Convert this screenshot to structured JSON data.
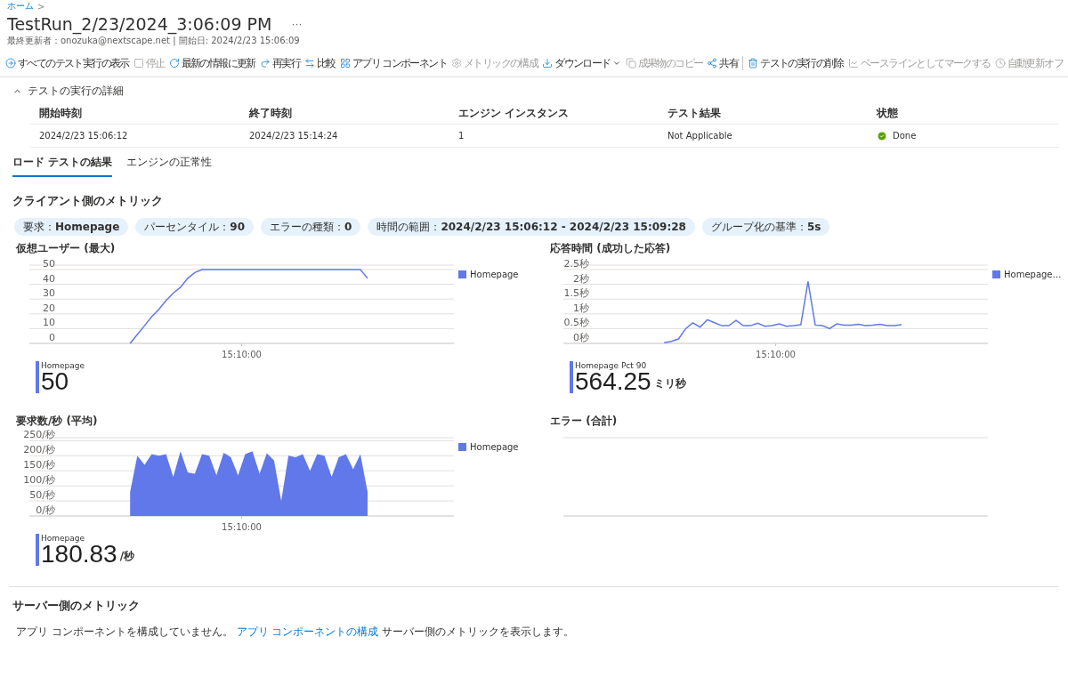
{
  "breadcrumb": {
    "label": "ホーム",
    "separator": ">"
  },
  "header": {
    "title": "TestRun_2/23/2024_3:06:09 PM",
    "more": "···",
    "subtitle": "最終更新者：onozuka@nextscape.net | 開始日: 2024/2/23 15:06:09"
  },
  "toolbar": [
    {
      "kind": "button",
      "label": "すべてのテスト実行の表示",
      "disabled": false
    },
    {
      "kind": "button",
      "label": "停止",
      "disabled": true
    },
    {
      "kind": "button",
      "label": "最新の情報に更新",
      "disabled": false
    },
    {
      "kind": "button",
      "label": "再実行",
      "disabled": false
    },
    {
      "kind": "button",
      "label": "比較",
      "disabled": false
    },
    {
      "kind": "button",
      "label": "アプリ コンポーネント",
      "disabled": false
    },
    {
      "kind": "button",
      "label": "メトリックの構成",
      "disabled": true
    },
    {
      "kind": "dropdown",
      "label": "ダウンロード",
      "disabled": false
    },
    {
      "kind": "button",
      "label": "成果物のコピー",
      "disabled": true
    },
    {
      "kind": "button",
      "label": "共有",
      "disabled": false
    },
    {
      "kind": "separator"
    },
    {
      "kind": "button",
      "label": "テストの実行の削除",
      "disabled": false
    },
    {
      "kind": "button",
      "label": "ベースラインとしてマークする",
      "disabled": true
    },
    {
      "kind": "button",
      "label": "自動更新オフ",
      "disabled": true
    }
  ],
  "details": {
    "title": "テストの実行の詳細",
    "expanded": true,
    "columns": [
      "開始時刻",
      "終了時刻",
      "エンジン インスタンス",
      "テスト結果",
      "状態"
    ],
    "rows": [
      [
        "2024/2/23 15:06:12",
        "2024/2/23 15:14:24",
        "1",
        "Not Applicable",
        "Done"
      ]
    ]
  },
  "tabs": [
    {
      "label": "ロード テストの結果",
      "selected": true
    },
    {
      "label": "エンジンの正常性",
      "selected": false
    }
  ],
  "client_metrics": {
    "title": "クライアント側のメトリック",
    "filters": [
      "要求：**Homepage**",
      "パーセンタイル：**90**",
      "エラーの種類：**0**",
      "時間の範囲：**2024/2/23 15:06:12 - 2024/2/23 15:09:28**",
      "グループ化の基準：**5s**"
    ],
    "panels": [
      {
        "title": "仮想ユーザー (最大)",
        "chart_data": {
          "type": "line",
          "grid": true,
          "ylim": [
            0,
            53
          ],
          "yticks": [
            {
              "value": 0,
              "label": "0"
            },
            {
              "value": 10,
              "label": "10"
            },
            {
              "value": 20,
              "label": "20"
            },
            {
              "value": 30,
              "label": "30"
            },
            {
              "value": 40,
              "label": "40"
            },
            {
              "value": 50,
              "label": "50"
            }
          ],
          "annotations": [
            {
              "text": "15:10:00"
            }
          ],
          "series": [
            {
              "name": "Homepage",
              "color": "#6078ea",
              "values": [
                null,
                null,
                null,
                null,
                null,
                null,
                null,
                null,
                null,
                null,
                null,
                null,
                null,
                null,
                0,
                6,
                12,
                18,
                23,
                29,
                34,
                38,
                44,
                48,
                50,
                50,
                50,
                50,
                50,
                50,
                50,
                50,
                50,
                50,
                50,
                50,
                50,
                50,
                50,
                50,
                50,
                50,
                50,
                50,
                50,
                50,
                50,
                44,
                null,
                null,
                null,
                null,
                null,
                null,
                null,
                null,
                null,
                null,
                null,
                null
              ]
            }
          ]
        },
        "stat": {
          "label": "Homepage",
          "value": "50"
        }
      },
      {
        "title": "応答時間 (成功した応答)",
        "chart_data": {
          "type": "line",
          "grid": true,
          "ylim": [
            0,
            2.65
          ],
          "yticks": [
            {
              "value": 0,
              "label": "0秒"
            },
            {
              "value": 0.5,
              "label": "0.5秒"
            },
            {
              "value": 1,
              "label": "1秒"
            },
            {
              "value": 1.5,
              "label": "1.5秒"
            },
            {
              "value": 2,
              "label": "2秒"
            },
            {
              "value": 2.5,
              "label": "2.5秒"
            }
          ],
          "annotations": [
            {
              "text": "15:10:00"
            }
          ],
          "series": [
            {
              "name": "Homepage…",
              "color": "#6078ea",
              "values": [
                null,
                null,
                null,
                null,
                null,
                null,
                null,
                null,
                null,
                null,
                null,
                null,
                null,
                null,
                0.02,
                0.07,
                0.15,
                0.5,
                0.7,
                0.55,
                0.8,
                0.7,
                0.6,
                0.6,
                0.78,
                0.6,
                0.6,
                0.68,
                0.58,
                0.6,
                0.66,
                0.58,
                0.6,
                0.63,
                2.1,
                0.62,
                0.6,
                0.5,
                0.66,
                0.62,
                0.62,
                0.65,
                0.6,
                0.62,
                0.65,
                0.6,
                0.6,
                0.63,
                null,
                null,
                null,
                null,
                null,
                null,
                null,
                null,
                null,
                null,
                null,
                null
              ]
            }
          ]
        },
        "stat": {
          "label": "Homepage Pct 90",
          "value": "564.25",
          "unit": "ミリ秒"
        }
      },
      {
        "title": "要求数/秒 (平均)",
        "chart_data": {
          "type": "area",
          "grid": true,
          "ylim": [
            0,
            260
          ],
          "yticks": [
            {
              "value": 0,
              "label": "0/秒"
            },
            {
              "value": 50,
              "label": "50/秒"
            },
            {
              "value": 100,
              "label": "100/秒"
            },
            {
              "value": 150,
              "label": "150/秒"
            },
            {
              "value": 200,
              "label": "200/秒"
            },
            {
              "value": 250,
              "label": "250/秒"
            }
          ],
          "annotations": [
            {
              "text": "15:10:00"
            }
          ],
          "series": [
            {
              "name": "Homepage",
              "color": "#6078ea",
              "values": [
                null,
                null,
                null,
                null,
                null,
                null,
                null,
                null,
                null,
                null,
                null,
                null,
                null,
                null,
                80,
                200,
                170,
                205,
                200,
                205,
                130,
                215,
                145,
                140,
                205,
                200,
                135,
                210,
                195,
                135,
                205,
                215,
                140,
                208,
                185,
                50,
                200,
                195,
                205,
                150,
                205,
                200,
                130,
                195,
                205,
                155,
                205,
                80,
                null,
                null,
                null,
                null,
                null,
                null,
                null,
                null,
                null,
                null,
                null,
                null
              ]
            }
          ]
        },
        "stat": {
          "label": "Homepage",
          "value": "180.83",
          "unit": "/秒"
        }
      },
      {
        "title": "エラー (合計)"
      }
    ]
  },
  "server_metrics": {
    "title": "サーバー側のメトリック",
    "text": "アプリ コンポーネントを構成していません。",
    "link": "アプリ コンポーネントの構成",
    "after": "サーバー側のメトリックを表示します。"
  }
}
